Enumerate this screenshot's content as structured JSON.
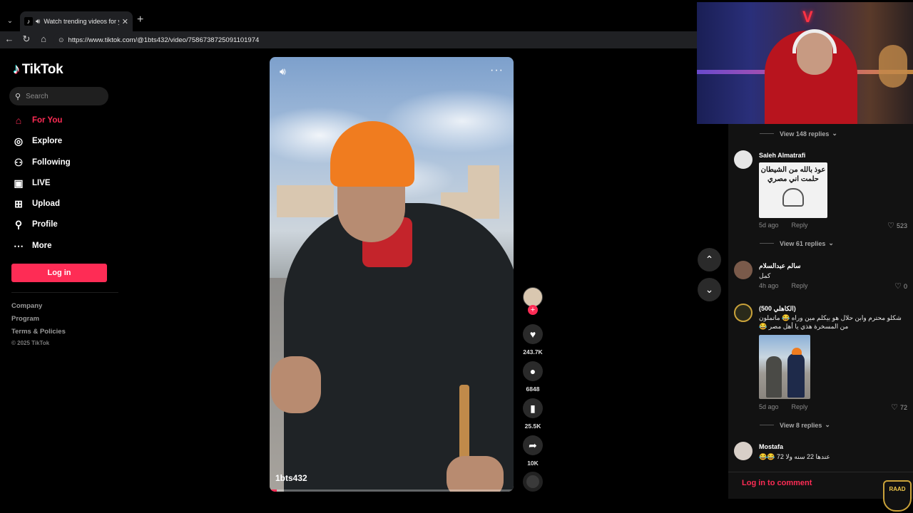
{
  "browser": {
    "tab_title": "Watch trending videos for yo",
    "url": "https://www.tiktok.com/@1bts432/video/7586738725091101974"
  },
  "sidebar": {
    "logo": "TikTok",
    "search_placeholder": "Search",
    "nav": [
      {
        "label": "For You",
        "icon": "home-icon",
        "active": true
      },
      {
        "label": "Explore",
        "icon": "compass-icon"
      },
      {
        "label": "Following",
        "icon": "user-plus-icon"
      },
      {
        "label": "LIVE",
        "icon": "live-tv-icon"
      },
      {
        "label": "Upload",
        "icon": "plus-square-icon"
      },
      {
        "label": "Profile",
        "icon": "person-icon"
      },
      {
        "label": "More",
        "icon": "ellipsis-icon"
      }
    ],
    "login_label": "Log in",
    "footer": [
      "Company",
      "Program",
      "Terms & Policies"
    ],
    "copyright": "© 2025 TikTok",
    "accent": "#fe2c55"
  },
  "video": {
    "author": "1bts432",
    "progress": 0.03
  },
  "actions": {
    "likes": "243.7K",
    "comments": "6848",
    "saves": "25.5K",
    "shares": "10K"
  },
  "comments": {
    "view_replies_top": "View 148 replies",
    "items": [
      {
        "name": "Saleh Almatrafi",
        "image_text": [
          "عوذ بالله من الشيطان",
          "حلمت اني مصري"
        ],
        "time": "5d ago",
        "reply": "Reply",
        "likes": "523",
        "view_replies": "View 61 replies"
      },
      {
        "name": "سالم عبدالسلام",
        "text": "كمل",
        "time": "4h ago",
        "reply": "Reply",
        "likes": "0"
      },
      {
        "name": "(الكاهلي 500)",
        "text": "شكلو محترم وابن حلال هو بيكلم مين وراه 😂 ماتملون من المسخرة هذي يا أهل مصر 😂",
        "time": "5d ago",
        "reply": "Reply",
        "likes": "72",
        "view_replies": "View 8 replies"
      },
      {
        "name": "Mostafa",
        "text": "عندها 22 سنه ولا 72 😂😂"
      }
    ],
    "login_to_comment": "Log in to comment"
  },
  "overlay": {
    "badge": "RAAD"
  }
}
